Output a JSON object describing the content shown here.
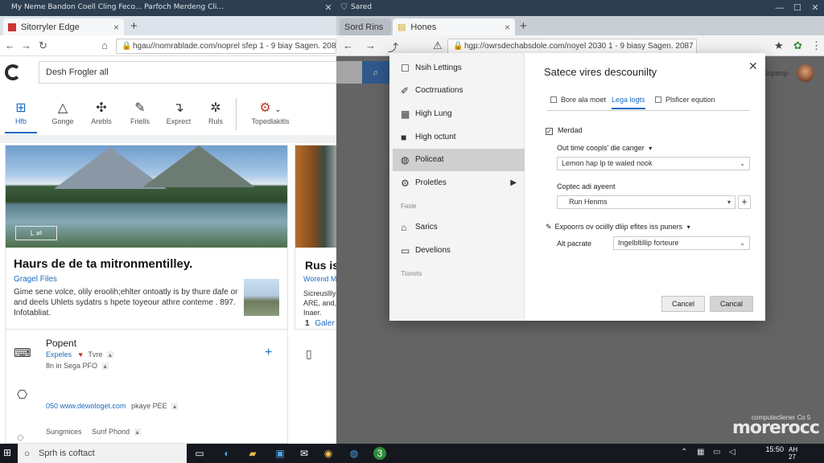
{
  "left_window": {
    "title": "My Neme     Bandon Coell Cling Feco...     Parfoch Merdeng Cli...",
    "tab_label": "Sitorryler Edge",
    "url": "hgau//nomrablade.com/noprel sfep 1 - 9 biay Sagen. 2087",
    "search_value": "Desh Frogler all",
    "categories": [
      {
        "label": "Hfb",
        "icon": "windows-icon"
      },
      {
        "label": "Gonge",
        "icon": "triangle-icon"
      },
      {
        "label": "Arebls",
        "icon": "puzzle-icon"
      },
      {
        "label": "Friells",
        "icon": "edit-icon"
      },
      {
        "label": "Exprect",
        "icon": "turn-arrow-icon"
      },
      {
        "label": "Ruls",
        "icon": "bug-icon"
      },
      {
        "label": "Topedlakitls",
        "icon": "gear-icon"
      }
    ],
    "card1": {
      "title": "Haurs de de ta mitronmentilley.",
      "source": "Gragel Files",
      "desc": "Gime sene volce, olily eroolih;ehlter ontoatly is by thure dafe or and deels Uhlets sydatrs s hpete toyeour athre conteme . 897. Infotabliat.",
      "overlay_label": "L ⇌"
    },
    "card2": {
      "title": "Rus is",
      "source": "Worend Maniellys Mat",
      "desc": "Sicreusllly ARE, and, Inaer.",
      "foot_num": "1",
      "foot_link": "Galer"
    },
    "list": [
      {
        "title": "Popent",
        "link": "Expeles",
        "badge_a": "Tvre",
        "sub": "8n in Sega PFO",
        "icon": "gamepad-icon"
      },
      {
        "title": "",
        "link": "050 www.dewologet.com",
        "badge_a": "pkaye PEE",
        "sub": "",
        "icon": "mouse-icon"
      },
      {
        "title": "Sungmices",
        "link": "",
        "badge_a": "Sunf Phond",
        "sub": "",
        "icon": "circle-icon"
      }
    ]
  },
  "right_window": {
    "title": "Sared",
    "tab_label_inactive": "Sord Rins",
    "tab_label_active": "Hones",
    "url": "hgp://owrsdechabsdole.com/noyel 2030 1 - 9 biasy Sagen. 2087",
    "bg_text": "Sopeop",
    "watermark": "morerocc",
    "watermark_small": "computecliener Co 5"
  },
  "dialog": {
    "title": "Satece vires descounilty",
    "menu": [
      {
        "label": "Nsih Lettings",
        "icon": "checkbox-icon"
      },
      {
        "label": "Coctrruations",
        "icon": "pen-icon"
      },
      {
        "label": "High Lung",
        "icon": "grid-icon"
      },
      {
        "label": "High octunt",
        "icon": "square-icon"
      },
      {
        "label": "Policeat",
        "icon": "globe-icon",
        "selected": true
      },
      {
        "label": "Proletles",
        "icon": "gear-icon",
        "has_submenu": true
      },
      {
        "label": "Sarics",
        "icon": "home-icon"
      },
      {
        "label": "Develions",
        "icon": "window-icon"
      }
    ],
    "section_labels": [
      "Fasle",
      "Tlonets"
    ],
    "tabs": [
      "Bore ala moet",
      "Lega logts",
      "Plsficer eqution"
    ],
    "checkbox_label": "Merdad",
    "field1_label": "Out time coopls' die canger",
    "field1_value": "Lemon hap lp te waled nook",
    "field2_label": "Coptec adi ayeent",
    "field2_value": "Run Henms",
    "field3_label": "Expoorrs ov ociilly dliip efites iss puners",
    "field4_label": "Alt pacrate",
    "field4_value": "Ingelbltillip forteure",
    "button1": "Cancel",
    "button2": "Cancal"
  },
  "taskbar": {
    "search_placeholder": "Sprh is coftact",
    "clock": "15:50",
    "date": "AH",
    "lang": "27"
  }
}
